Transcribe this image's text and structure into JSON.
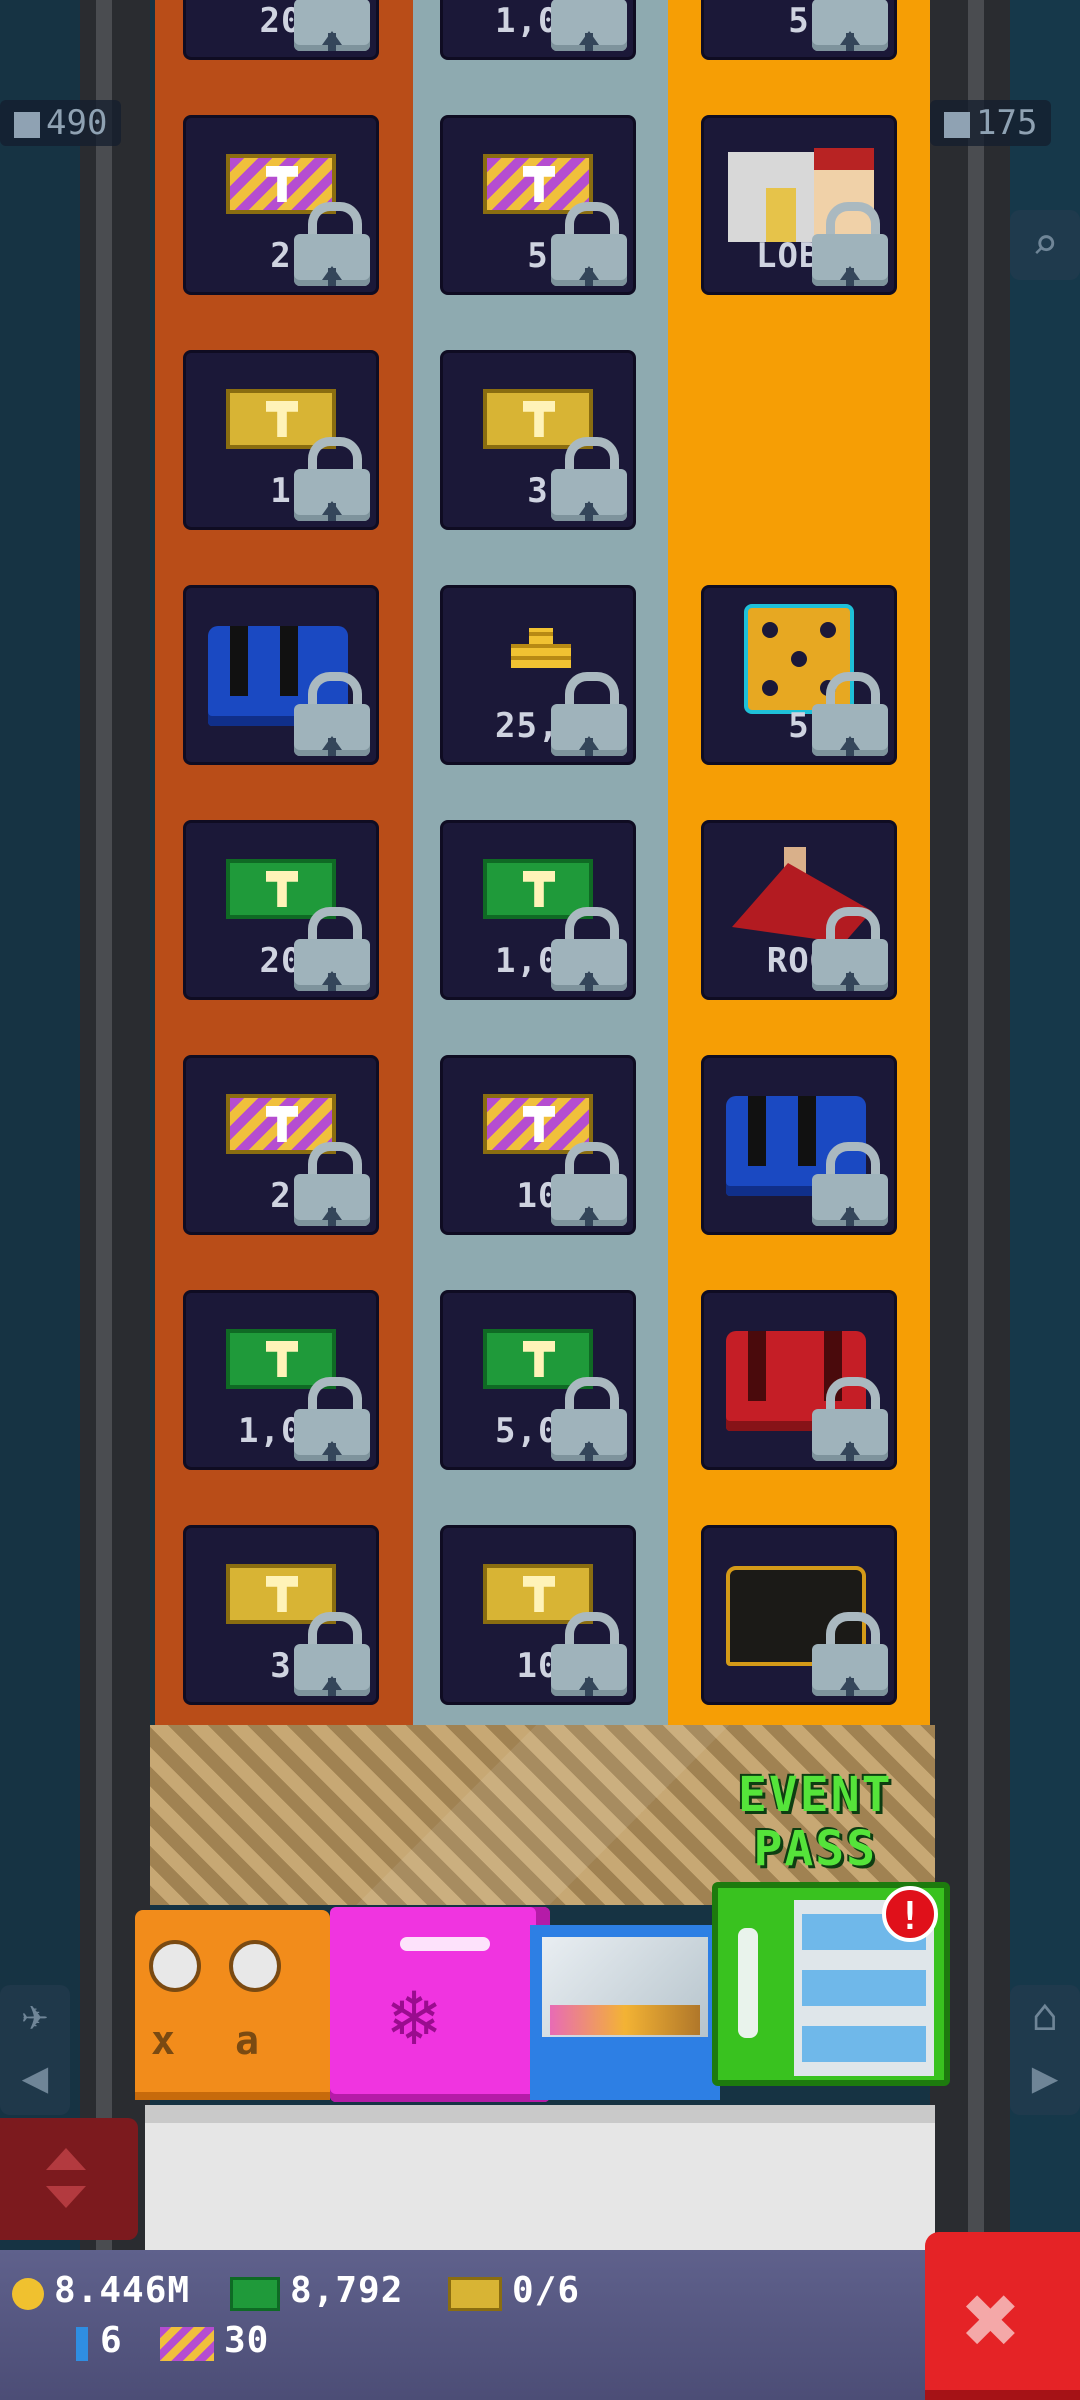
{
  "hud": {
    "population": "490",
    "floors": "175",
    "population_icon": "person-icon",
    "floors_icon": "building-icon"
  },
  "columns": [
    {
      "name": "left",
      "color": "#b94d18",
      "tiles": [
        {
          "item": "cash",
          "label": "20"
        },
        {
          "item": "striped-ticket",
          "label": "2"
        },
        {
          "item": "gold-ticket",
          "label": "1"
        },
        {
          "item": "blue-chest",
          "label": ""
        },
        {
          "item": "cash",
          "label": "20"
        },
        {
          "item": "striped-ticket",
          "label": "2"
        },
        {
          "item": "cash",
          "label": "1,00"
        },
        {
          "item": "gold-ticket",
          "label": "3"
        }
      ]
    },
    {
      "name": "middle",
      "color": "#8eaab0",
      "tiles": [
        {
          "item": "cash",
          "label": "1,00"
        },
        {
          "item": "striped-ticket",
          "label": "5"
        },
        {
          "item": "gold-ticket",
          "label": "3"
        },
        {
          "item": "coins",
          "label": "25,0"
        },
        {
          "item": "cash",
          "label": "1,00"
        },
        {
          "item": "striped-ticket",
          "label": "10"
        },
        {
          "item": "cash",
          "label": "5,00"
        },
        {
          "item": "gold-ticket",
          "label": "10"
        }
      ]
    },
    {
      "name": "right",
      "color": "#f69e05",
      "tiles": [
        {
          "item": "cash",
          "label": "5"
        },
        {
          "item": "lobby",
          "label": "LOBB"
        },
        {
          "item": "empty",
          "label": ""
        },
        {
          "item": "dice",
          "label": "5"
        },
        {
          "item": "roof",
          "label": "ROO"
        },
        {
          "item": "blue-chest",
          "label": ""
        },
        {
          "item": "red-chest",
          "label": ""
        },
        {
          "item": "black-chest",
          "label": ""
        }
      ]
    }
  ],
  "event_pass": {
    "title_line1": "EVENT",
    "title_line2": "PASS",
    "alert": "!"
  },
  "machines": {
    "oven_glyph_left": "x",
    "oven_glyph_right": "a"
  },
  "side_buttons": {
    "left_top": "✈",
    "left_bottom": "◀",
    "right_top": "⌂",
    "right_bottom": "▶",
    "zoom": "⌕"
  },
  "resources": {
    "coins": "8.446M",
    "cash": "8,792",
    "tickets": "0/6",
    "bux": "6",
    "striped_tickets": "30"
  },
  "close": {
    "label": "✖"
  }
}
